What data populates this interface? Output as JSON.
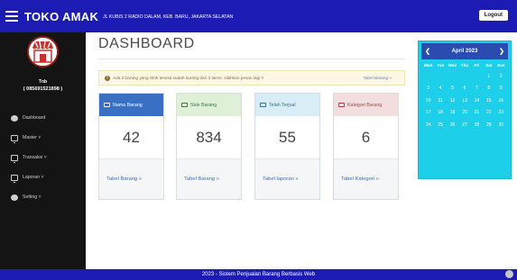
{
  "header": {
    "brand": "TOKO AMAK",
    "address": "JL KUBIS 2 RADIO DALAM, KEB. BARU, JAKARTA SELATAN",
    "logout_label": "Logout"
  },
  "sidebar": {
    "user_name": "Tnb",
    "user_phone": "( 085691521898 )",
    "items": [
      {
        "label": "Dashboard",
        "icon": "dashboard-icon"
      },
      {
        "label": "Master ˅",
        "icon": "monitor-icon"
      },
      {
        "label": "Transaksi ˅",
        "icon": "monitor-icon"
      },
      {
        "label": "Laporan ˅",
        "icon": "monitor-icon"
      },
      {
        "label": "Setting ˅",
        "icon": "gear-icon"
      }
    ]
  },
  "main": {
    "title": "DASHBOARD",
    "alert_text": "Ada 2 barang yang Stok tersisa sudah kurang dari 3 items. silahkan pesan lagi !!",
    "alert_link": "Tabel Barang »",
    "cards": [
      {
        "label": "Nama Barang",
        "value": "42",
        "link": "Tabel Barang »",
        "head_bg": "#3a70c4",
        "head_color": "#ffffff"
      },
      {
        "label": "Stok Barang",
        "value": "834",
        "link": "Tabel Barang »",
        "head_bg": "#dff0d8",
        "head_color": "#3c763d"
      },
      {
        "label": "Telah Terjual",
        "value": "55",
        "link": "Tabel laporan »",
        "head_bg": "#d9edf7",
        "head_color": "#31708f"
      },
      {
        "label": "Kategori Barang",
        "value": "6",
        "link": "Tabel Kategori »",
        "head_bg": "#f2dede",
        "head_color": "#a94442"
      }
    ]
  },
  "calendar": {
    "month_label": "April 2023",
    "prev": "❮",
    "next": "❯",
    "days_of_week": [
      "Mon",
      "Tue",
      "Wed",
      "Thu",
      "Fri",
      "Sat",
      "Sun"
    ],
    "weeks": [
      [
        "",
        "",
        "",
        "",
        "",
        "1",
        "2"
      ],
      [
        "3",
        "4",
        "5",
        "6",
        "7",
        "8",
        "9"
      ],
      [
        "10",
        "11",
        "12",
        "13",
        "14",
        "15",
        "16"
      ],
      [
        "17",
        "18",
        "19",
        "20",
        "21",
        "22",
        "23"
      ],
      [
        "24",
        "25",
        "26",
        "27",
        "28",
        "29",
        "30"
      ]
    ]
  },
  "footer": {
    "text": "2023 - Sistem Penjualan Barang Berbasis Web"
  },
  "colors": {
    "primary_bar": "#1c1cb4",
    "sidebar": "#141414",
    "calendar": "#1ecfea"
  }
}
